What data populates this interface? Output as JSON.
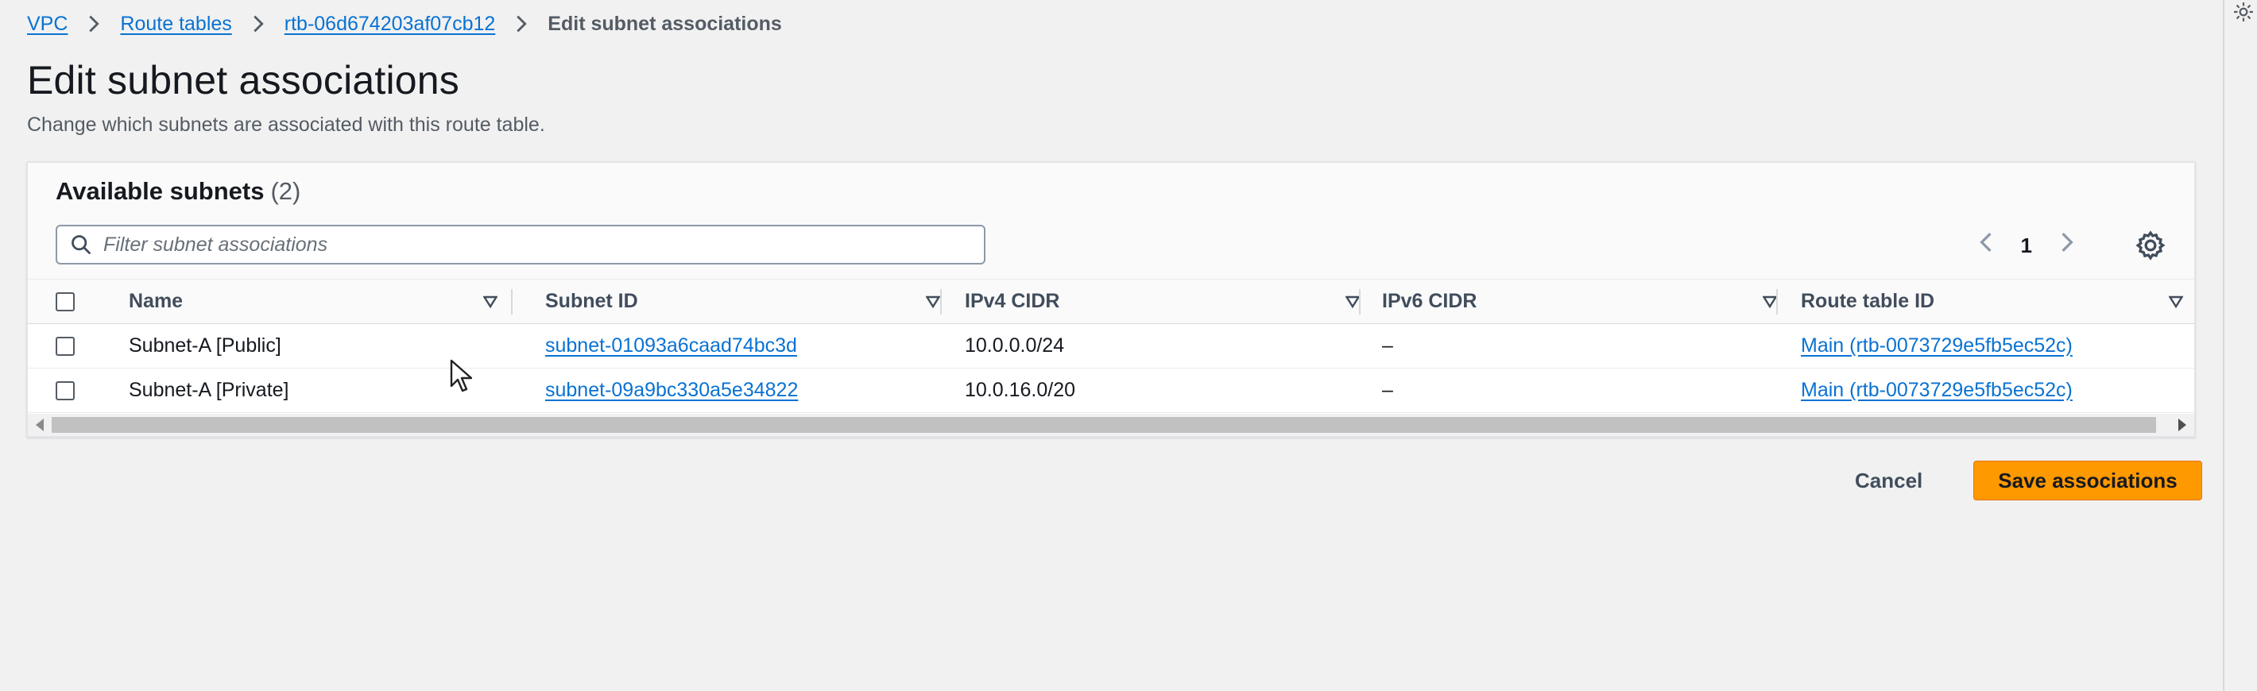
{
  "breadcrumb": {
    "items": [
      "VPC",
      "Route tables",
      "rtb-06d674203af07cb12"
    ],
    "current": "Edit subnet associations"
  },
  "header": {
    "title": "Edit subnet associations",
    "description": "Change which subnets are associated with this route table."
  },
  "panel": {
    "title": "Available subnets",
    "count": "(2)",
    "filter_placeholder": "Filter subnet associations",
    "filter_value": "",
    "page": "1"
  },
  "table": {
    "columns": [
      "Name",
      "Subnet ID",
      "IPv4 CIDR",
      "IPv6 CIDR",
      "Route table ID"
    ],
    "rows": [
      {
        "checked": false,
        "name": "Subnet-A [Public]",
        "subnet_id": "subnet-01093a6caad74bc3d",
        "ipv4": "10.0.0.0/24",
        "ipv6": "–",
        "route_table": "Main (rtb-0073729e5fb5ec52c)"
      },
      {
        "checked": false,
        "name": "Subnet-A [Private]",
        "subnet_id": "subnet-09a9bc330a5e34822",
        "ipv4": "10.0.16.0/20",
        "ipv6": "–",
        "route_table": "Main (rtb-0073729e5fb5ec52c)"
      }
    ]
  },
  "footer": {
    "cancel_label": "Cancel",
    "save_label": "Save associations"
  },
  "colors": {
    "link": "#0972d3",
    "primary_button": "#ff9900",
    "background": "#f1f1f1"
  },
  "icons": [
    "chevron-right-icon",
    "search-icon",
    "chevron-left-icon",
    "settings-gear-icon",
    "sort-caret-icon",
    "cursor-pointer-icon"
  ]
}
